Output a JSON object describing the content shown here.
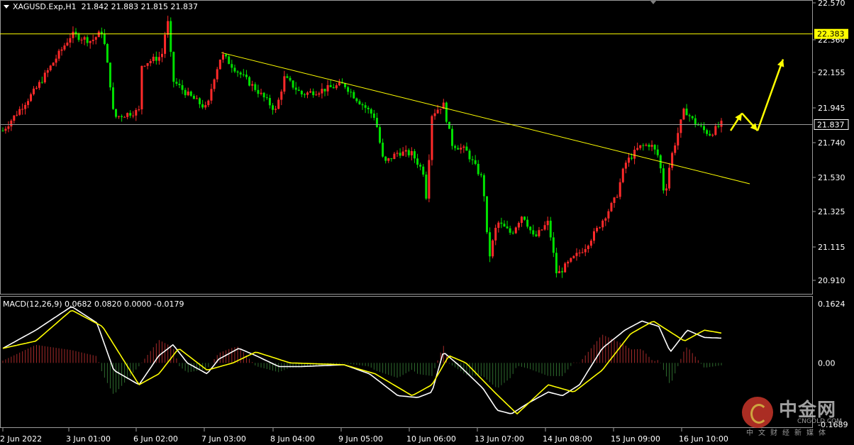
{
  "header": {
    "symbol_line": "XAGUSD.Exp,H1  21.842 21.883 21.815 21.837"
  },
  "watermark": {
    "name": "中金网",
    "domain": "CNGOLD.COM",
    "tagline": "中文财经新媒体"
  },
  "colors": {
    "background": "#000000",
    "bull": "#ff2a2a",
    "bear": "#00e000",
    "level_line": "#ffff00",
    "price_line": "#9a9a9a",
    "macd_line": "#ffffff",
    "signal_line": "#ffff00",
    "hist_pos": "#a52a2a",
    "hist_neg": "#2e6b2e",
    "arrow": "#ffff00"
  },
  "chart_data": [
    {
      "type": "candlestick",
      "title": "XAGUSD.Exp,H1",
      "ohlc_current": {
        "open": 21.842,
        "high": 21.883,
        "low": 21.815,
        "close": 21.837
      },
      "y_ticks": [
        "22.570",
        "22.360",
        "22.155",
        "21.945",
        "21.740",
        "21.530",
        "21.325",
        "21.115",
        "20.910"
      ],
      "ylim": [
        20.86,
        22.57
      ],
      "x_ticks": [
        "2 Jun 2022",
        "3 Jun 01:00",
        "6 Jun 02:00",
        "7 Jun 03:00",
        "8 Jun 04:00",
        "9 Jun 05:00",
        "10 Jun 06:00",
        "13 Jun 07:00",
        "14 Jun 08:00",
        "15 Jun 09:00",
        "16 Jun 10:00"
      ],
      "horizontal_levels": [
        {
          "value": 22.383,
          "label": "22.383",
          "style": "resistance"
        },
        {
          "value": 21.837,
          "label": "21.837",
          "style": "current_price"
        }
      ],
      "trendline": [
        {
          "x": "7 Jun 06:00",
          "y": 22.27
        },
        {
          "x": "17 Jun 00:00",
          "y": 21.48
        }
      ],
      "projection_arrows": [
        {
          "y": [
            21.8,
            21.905
          ]
        },
        {
          "y": [
            21.905,
            21.8
          ]
        },
        {
          "y": [
            21.8,
            22.23
          ]
        }
      ],
      "price_path": [
        {
          "x": "2 Jun 2022",
          "y": 21.8
        },
        {
          "x": "2 Jun 12:00",
          "y": 22.05
        },
        {
          "x": "3 Jun 01:00",
          "y": 22.38
        },
        {
          "x": "3 Jun 08:00",
          "y": 22.34
        },
        {
          "x": "3 Jun 12:00",
          "y": 22.4
        },
        {
          "x": "3 Jun 15:00",
          "y": 22.05
        },
        {
          "x": "3 Jun 16:00",
          "y": 21.88
        },
        {
          "x": "6 Jun 01:00",
          "y": 21.92
        },
        {
          "x": "6 Jun 02:00",
          "y": 22.2
        },
        {
          "x": "6 Jun 09:00",
          "y": 22.25
        },
        {
          "x": "6 Jun 11:00",
          "y": 22.48
        },
        {
          "x": "6 Jun 13:00",
          "y": 22.1
        },
        {
          "x": "6 Jun 18:00",
          "y": 22.02
        },
        {
          "x": "7 Jun 01:00",
          "y": 21.93
        },
        {
          "x": "7 Jun 03:00",
          "y": 22.1
        },
        {
          "x": "7 Jun 06:00",
          "y": 22.26
        },
        {
          "x": "7 Jun 12:00",
          "y": 22.15
        },
        {
          "x": "7 Jun 18:00",
          "y": 22.05
        },
        {
          "x": "8 Jun 01:00",
          "y": 21.92
        },
        {
          "x": "8 Jun 04:00",
          "y": 22.12
        },
        {
          "x": "8 Jun 10:00",
          "y": 22.02
        },
        {
          "x": "8 Jun 16:00",
          "y": 22.04
        },
        {
          "x": "9 Jun 01:00",
          "y": 22.08
        },
        {
          "x": "9 Jun 05:00",
          "y": 22.0
        },
        {
          "x": "9 Jun 12:00",
          "y": 21.88
        },
        {
          "x": "9 Jun 15:00",
          "y": 21.6
        },
        {
          "x": "9 Jun 20:00",
          "y": 21.67
        },
        {
          "x": "10 Jun 01:00",
          "y": 21.66
        },
        {
          "x": "10 Jun 05:00",
          "y": 21.55
        },
        {
          "x": "10 Jun 06:00",
          "y": 21.4
        },
        {
          "x": "10 Jun 08:00",
          "y": 21.9
        },
        {
          "x": "10 Jun 12:00",
          "y": 21.96
        },
        {
          "x": "10 Jun 15:00",
          "y": 21.72
        },
        {
          "x": "10 Jun 20:00",
          "y": 21.68
        },
        {
          "x": "13 Jun 02:00",
          "y": 21.5
        },
        {
          "x": "13 Jun 04:00",
          "y": 21.02
        },
        {
          "x": "13 Jun 07:00",
          "y": 21.25
        },
        {
          "x": "13 Jun 12:00",
          "y": 21.18
        },
        {
          "x": "13 Jun 16:00",
          "y": 21.3
        },
        {
          "x": "13 Jun 20:00",
          "y": 21.15
        },
        {
          "x": "14 Jun 01:00",
          "y": 21.25
        },
        {
          "x": "14 Jun 04:00",
          "y": 20.93
        },
        {
          "x": "14 Jun 08:00",
          "y": 21.0
        },
        {
          "x": "14 Jun 14:00",
          "y": 21.1
        },
        {
          "x": "14 Jun 18:00",
          "y": 21.2
        },
        {
          "x": "15 Jun 01:00",
          "y": 21.4
        },
        {
          "x": "15 Jun 04:00",
          "y": 21.6
        },
        {
          "x": "15 Jun 09:00",
          "y": 21.7
        },
        {
          "x": "15 Jun 13:00",
          "y": 21.72
        },
        {
          "x": "15 Jun 16:00",
          "y": 21.64
        },
        {
          "x": "15 Jun 18:00",
          "y": 21.4
        },
        {
          "x": "15 Jun 20:00",
          "y": 21.62
        },
        {
          "x": "16 Jun 01:00",
          "y": 21.93
        },
        {
          "x": "16 Jun 04:00",
          "y": 21.86
        },
        {
          "x": "16 Jun 08:00",
          "y": 21.8
        },
        {
          "x": "16 Jun 10:00",
          "y": 21.78
        },
        {
          "x": "16 Jun 14:00",
          "y": 21.84
        }
      ]
    },
    {
      "type": "line",
      "title": "MACD(12,26,9)",
      "label_line": "MACD(12,26,9) 0.0682 0.0820 0.0000 -0.0179",
      "values_current": {
        "macd": 0.0682,
        "signal": 0.082,
        "histogram_up": 0.0,
        "histogram_down": -0.0179
      },
      "y_ticks": [
        "0.1624",
        "0.00",
        "-0.1689"
      ],
      "ylim": [
        -0.1689,
        0.1624
      ],
      "macd_path": [
        {
          "x": "2 Jun 2022",
          "y": 0.04
        },
        {
          "x": "2 Jun 12:00",
          "y": 0.09
        },
        {
          "x": "3 Jun 01:00",
          "y": 0.155
        },
        {
          "x": "3 Jun 10:00",
          "y": 0.11
        },
        {
          "x": "3 Jun 16:00",
          "y": -0.02
        },
        {
          "x": "6 Jun 01:00",
          "y": -0.06
        },
        {
          "x": "6 Jun 08:00",
          "y": 0.02
        },
        {
          "x": "6 Jun 13:00",
          "y": 0.05
        },
        {
          "x": "6 Jun 18:00",
          "y": 0.0
        },
        {
          "x": "7 Jun 01:00",
          "y": -0.03
        },
        {
          "x": "7 Jun 05:00",
          "y": 0.01
        },
        {
          "x": "7 Jun 12:00",
          "y": 0.04
        },
        {
          "x": "7 Jun 18:00",
          "y": 0.02
        },
        {
          "x": "8 Jun 02:00",
          "y": -0.01
        },
        {
          "x": "8 Jun 10:00",
          "y": -0.01
        },
        {
          "x": "9 Jun 01:00",
          "y": -0.005
        },
        {
          "x": "9 Jun 10:00",
          "y": -0.03
        },
        {
          "x": "9 Jun 20:00",
          "y": -0.09
        },
        {
          "x": "10 Jun 03:00",
          "y": -0.095
        },
        {
          "x": "10 Jun 08:00",
          "y": -0.08
        },
        {
          "x": "10 Jun 12:00",
          "y": 0.03
        },
        {
          "x": "10 Jun 18:00",
          "y": -0.01
        },
        {
          "x": "13 Jun 02:00",
          "y": -0.07
        },
        {
          "x": "13 Jun 07:00",
          "y": -0.13
        },
        {
          "x": "13 Jun 12:00",
          "y": -0.14
        },
        {
          "x": "13 Jun 18:00",
          "y": -0.11
        },
        {
          "x": "14 Jun 01:00",
          "y": -0.08
        },
        {
          "x": "14 Jun 06:00",
          "y": -0.09
        },
        {
          "x": "14 Jun 12:00",
          "y": -0.06
        },
        {
          "x": "14 Jun 20:00",
          "y": 0.04
        },
        {
          "x": "15 Jun 04:00",
          "y": 0.09
        },
        {
          "x": "15 Jun 10:00",
          "y": 0.115
        },
        {
          "x": "15 Jun 16:00",
          "y": 0.1
        },
        {
          "x": "15 Jun 20:00",
          "y": 0.03
        },
        {
          "x": "16 Jun 02:00",
          "y": 0.09
        },
        {
          "x": "16 Jun 08:00",
          "y": 0.07
        },
        {
          "x": "16 Jun 14:00",
          "y": 0.068
        }
      ],
      "signal_path": [
        {
          "x": "2 Jun 2022",
          "y": 0.04
        },
        {
          "x": "2 Jun 12:00",
          "y": 0.06
        },
        {
          "x": "3 Jun 01:00",
          "y": 0.145
        },
        {
          "x": "3 Jun 12:00",
          "y": 0.1
        },
        {
          "x": "6 Jun 01:00",
          "y": -0.06
        },
        {
          "x": "6 Jun 08:00",
          "y": -0.03
        },
        {
          "x": "6 Jun 15:00",
          "y": 0.04
        },
        {
          "x": "7 Jun 01:00",
          "y": -0.02
        },
        {
          "x": "7 Jun 10:00",
          "y": 0.0
        },
        {
          "x": "7 Jun 18:00",
          "y": 0.03
        },
        {
          "x": "8 Jun 06:00",
          "y": 0.0
        },
        {
          "x": "9 Jun 01:00",
          "y": -0.005
        },
        {
          "x": "9 Jun 12:00",
          "y": -0.03
        },
        {
          "x": "10 Jun 01:00",
          "y": -0.09
        },
        {
          "x": "10 Jun 08:00",
          "y": -0.06
        },
        {
          "x": "10 Jun 14:00",
          "y": 0.02
        },
        {
          "x": "10 Jun 20:00",
          "y": 0.0
        },
        {
          "x": "13 Jun 06:00",
          "y": -0.08
        },
        {
          "x": "13 Jun 14:00",
          "y": -0.14
        },
        {
          "x": "14 Jun 01:00",
          "y": -0.06
        },
        {
          "x": "14 Jun 10:00",
          "y": -0.08
        },
        {
          "x": "14 Jun 20:00",
          "y": -0.02
        },
        {
          "x": "15 Jun 06:00",
          "y": 0.08
        },
        {
          "x": "15 Jun 14:00",
          "y": 0.115
        },
        {
          "x": "16 Jun 01:00",
          "y": 0.06
        },
        {
          "x": "16 Jun 08:00",
          "y": 0.09
        },
        {
          "x": "16 Jun 14:00",
          "y": 0.082
        }
      ]
    }
  ]
}
